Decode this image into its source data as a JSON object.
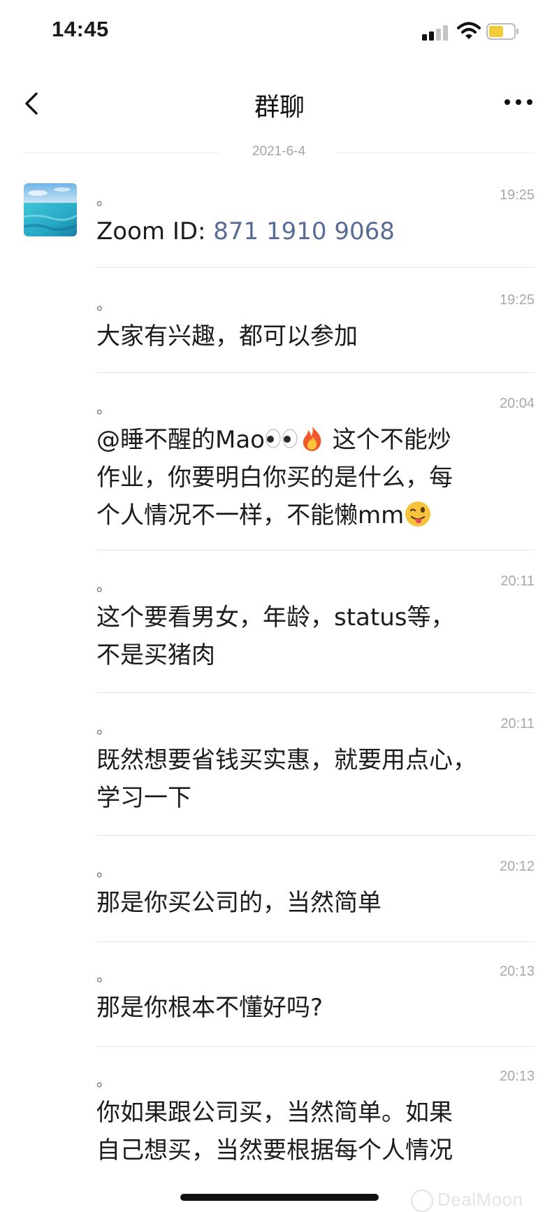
{
  "status_bar": {
    "time": "14:45"
  },
  "nav": {
    "title": "群聊"
  },
  "date_separator": "2021-6-4",
  "messages": [
    {
      "sender": "。",
      "time": "19:25",
      "text_prefix": "Zoom ID: ",
      "link_text": "871 1910 9068"
    },
    {
      "sender": "。",
      "time": "19:25",
      "text": "大家有兴趣，都可以参加"
    },
    {
      "sender": "。",
      "time": "20:04",
      "line1_a": "@睡不醒的Mao",
      "line1_b": " 这个不能炒",
      "line2": "作业，你要明白你买的是什么，每",
      "line3": "个人情况不一样，不能懒mm"
    },
    {
      "sender": "。",
      "time": "20:11",
      "line1": "这个要看男女，年龄，status等，",
      "line2": "不是买猪肉"
    },
    {
      "sender": "。",
      "time": "20:11",
      "line1": "既然想要省钱买实惠，就要用点心，",
      "line2": "学习一下"
    },
    {
      "sender": "。",
      "time": "20:12",
      "text": "那是你买公司的，当然简单"
    },
    {
      "sender": "。",
      "time": "20:13",
      "text": "那是你根本不懂好吗?"
    },
    {
      "sender": "。",
      "time": "20:13",
      "line1": "你如果跟公司买，当然简单。如果",
      "line2": "自己想买，当然要根据每个人情况"
    }
  ],
  "emoji": {
    "eyes": "eyes-emoji",
    "fire": "fire-emoji",
    "wink": "winking-tongue-emoji"
  },
  "colors": {
    "link": "#576b95",
    "battery_fill": "#f3cc3a"
  },
  "watermark": "DealMoon"
}
